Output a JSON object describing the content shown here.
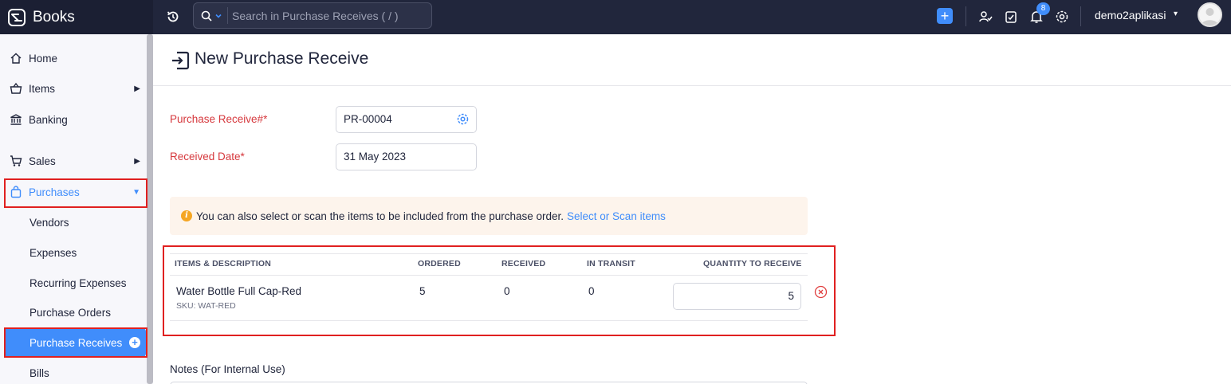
{
  "app": {
    "name": "Books"
  },
  "search": {
    "placeholder": "Search in Purchase Receives ( / )"
  },
  "topbar": {
    "notification_count": "8",
    "org_name": "demo2aplikasi",
    "quick_add": "+"
  },
  "sidebar": {
    "items": [
      {
        "label": "Home",
        "icon": "home-icon"
      },
      {
        "label": "Items",
        "icon": "basket-icon"
      },
      {
        "label": "Banking",
        "icon": "bank-icon"
      },
      {
        "label": "Sales",
        "icon": "cart-icon"
      },
      {
        "label": "Purchases",
        "icon": "bag-icon"
      }
    ],
    "purchases_sub": [
      "Vendors",
      "Expenses",
      "Recurring Expenses",
      "Purchase Orders",
      "Purchase Receives",
      "Bills"
    ]
  },
  "page": {
    "title": "New Purchase Receive"
  },
  "form": {
    "receive_no_label": "Purchase Receive#*",
    "receive_no_value": "PR-00004",
    "date_label": "Received Date*",
    "date_value": "31 May 2023"
  },
  "banner": {
    "text": "You can also select or scan the items to be included from the purchase order.",
    "link": "Select or Scan items"
  },
  "table": {
    "headers": [
      "ITEMS & DESCRIPTION",
      "ORDERED",
      "RECEIVED",
      "IN TRANSIT",
      "QUANTITY TO RECEIVE"
    ],
    "rows": [
      {
        "item": "Water Bottle Full Cap-Red",
        "sku": "SKU: WAT-RED",
        "ordered": "5",
        "received": "0",
        "in_transit": "0",
        "qty": "5"
      }
    ]
  },
  "notes": {
    "label": "Notes (For Internal Use)"
  },
  "colors": {
    "accent": "#408dfb",
    "topbar": "#21263c",
    "required": "#d6383d",
    "highlight": "#e02020"
  }
}
